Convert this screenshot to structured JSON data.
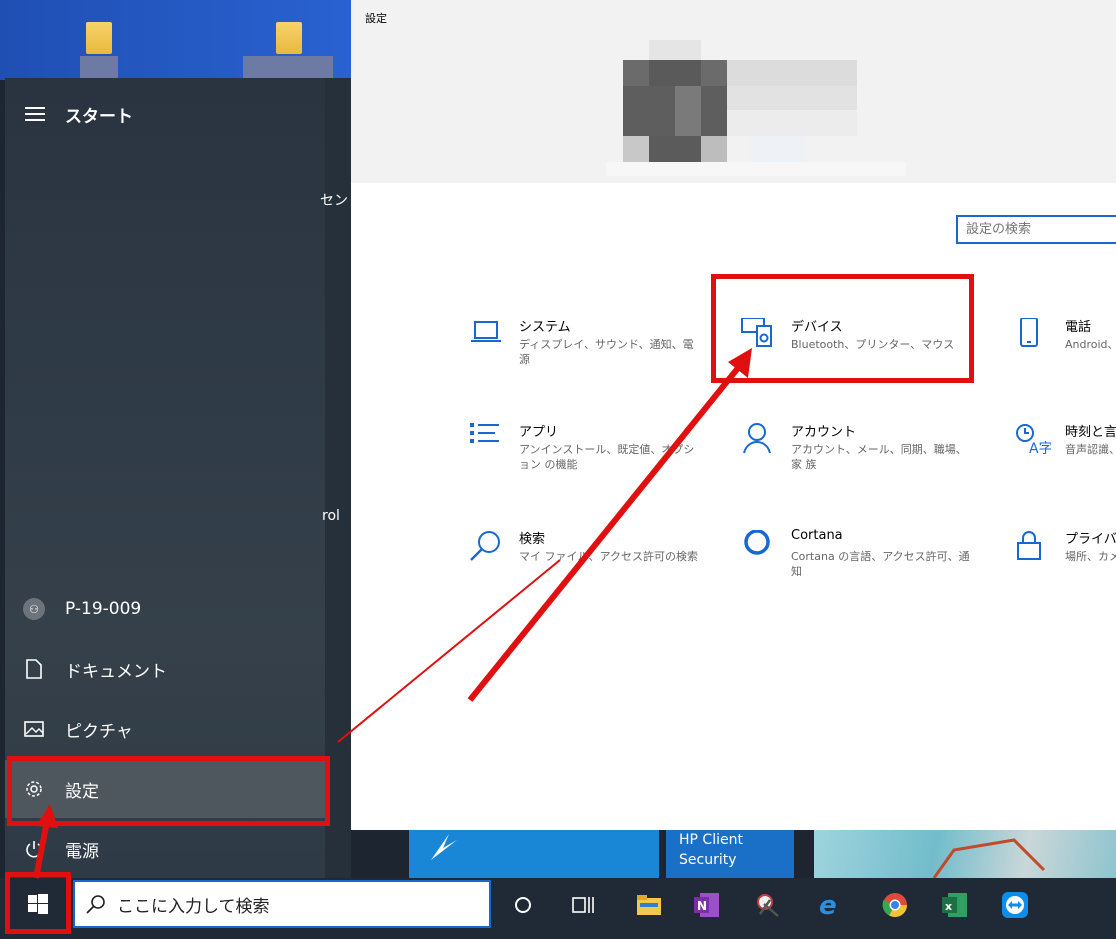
{
  "settings": {
    "window_title": "設定",
    "search_placeholder": "設定の検索",
    "categories": [
      {
        "title": "システム",
        "desc": "ディスプレイ、サウンド、通知、電源"
      },
      {
        "title": "デバイス",
        "desc": "Bluetooth、プリンター、マウス"
      },
      {
        "title": "電話",
        "desc": "Android、"
      },
      {
        "title": "アプリ",
        "desc": "アンインストール、既定値、オプション の機能"
      },
      {
        "title": "アカウント",
        "desc": "アカウント、メール、同期、職場、家 族"
      },
      {
        "title": "時刻と言",
        "desc": "音声認識、"
      },
      {
        "title": "検索",
        "desc": "マイ ファイル、アクセス許可の検索"
      },
      {
        "title": "Cortana",
        "desc": "Cortana の言語、アクセス許可、通 知"
      },
      {
        "title": "プライバシ",
        "desc": "場所、カメ"
      }
    ]
  },
  "start_menu": {
    "title": "スタート",
    "user": "P-19-009",
    "items": [
      {
        "label": "ドキュメント",
        "icon": "document-icon"
      },
      {
        "label": "ピクチャ",
        "icon": "pictures-icon"
      },
      {
        "label": "設定",
        "icon": "gear-icon"
      },
      {
        "label": "電源",
        "icon": "power-icon"
      }
    ],
    "fragments": {
      "a": "セン",
      "b": "rol"
    }
  },
  "tiles": {
    "hp_client_security": "HP Client Security"
  },
  "taskbar": {
    "search_placeholder": "ここに入力して検索",
    "icons": [
      "cortana-circle-icon",
      "task-view-icon",
      "file-explorer-icon",
      "onenote-icon",
      "snipping-tool-icon",
      "internet-explorer-icon",
      "chrome-icon",
      "excel-icon",
      "teamviewer-icon"
    ]
  },
  "colors": {
    "highlight_red": "#e01010",
    "accent_blue": "#1769d1",
    "taskbar": "#1f2a36"
  }
}
